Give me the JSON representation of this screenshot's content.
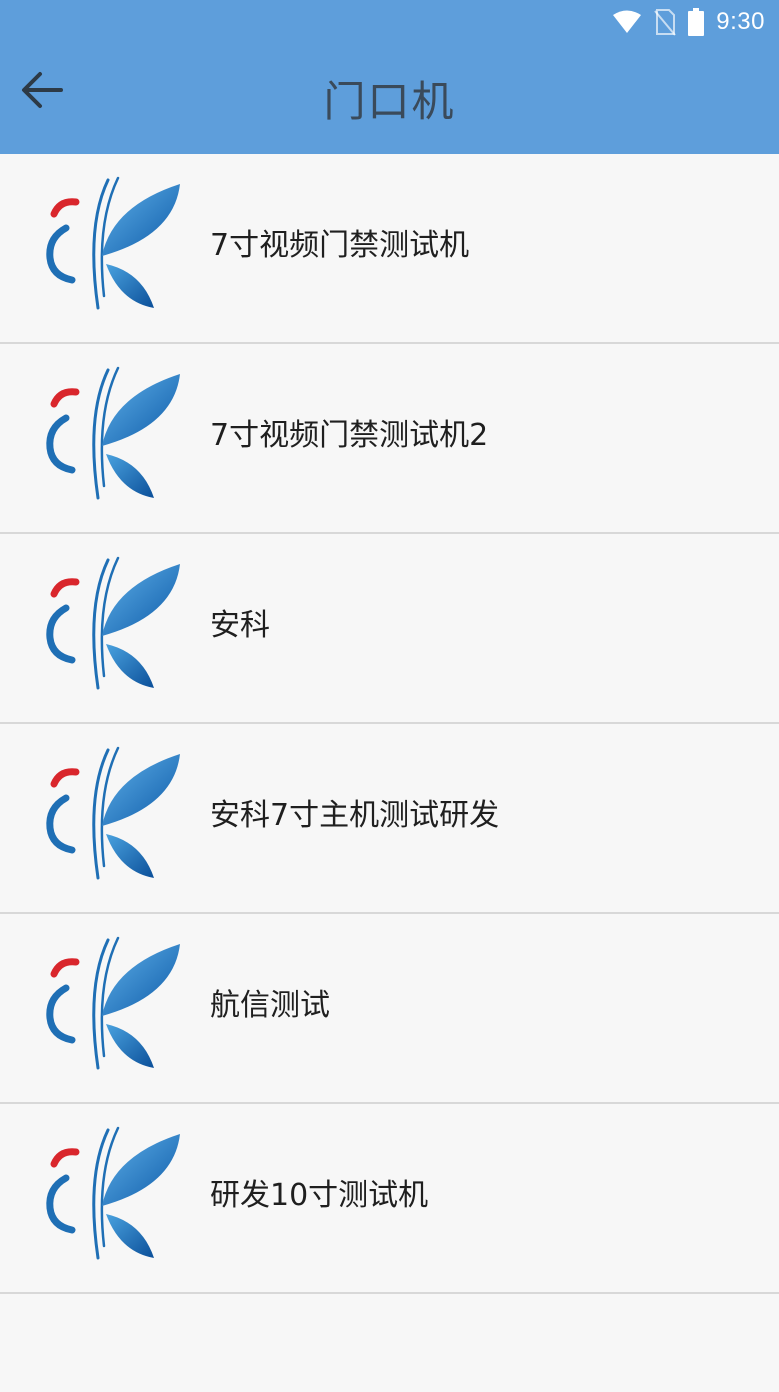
{
  "status_bar": {
    "time": "9:30",
    "icons": [
      "wifi-icon",
      "no-sim-icon",
      "battery-icon"
    ]
  },
  "toolbar": {
    "back_icon": "arrow-left-icon",
    "title": "门口机"
  },
  "devices": [
    {
      "name": "7寸视频门禁测试机",
      "logo": "anke-logo-icon"
    },
    {
      "name": "7寸视频门禁测试机2",
      "logo": "anke-logo-icon"
    },
    {
      "name": "安科",
      "logo": "anke-logo-icon"
    },
    {
      "name": "安科7寸主机测试研发",
      "logo": "anke-logo-icon"
    },
    {
      "name": "航信测试",
      "logo": "anke-logo-icon"
    },
    {
      "name": "研发10寸测试机",
      "logo": "anke-logo-icon"
    }
  ],
  "colors": {
    "appbar": "#5e9edb",
    "background": "#f7f7f7",
    "divider": "#d8d8d8",
    "logo_blue": "#1f6fb5",
    "logo_red": "#d9262c"
  }
}
